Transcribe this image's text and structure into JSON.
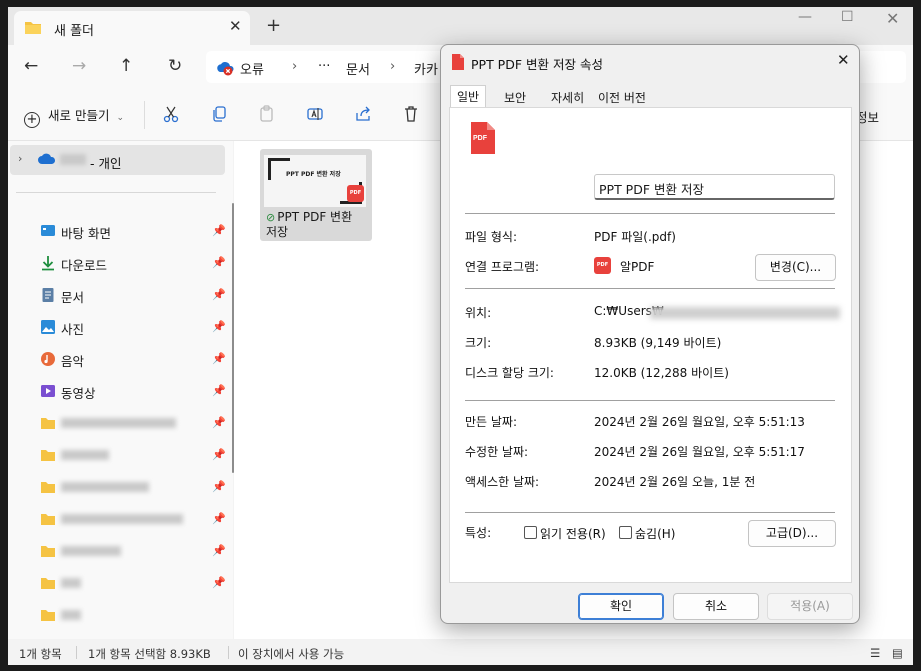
{
  "explorer": {
    "tab_title": "새 폴더",
    "breadcrumb": [
      "오류",
      "···",
      "문서",
      "카카"
    ],
    "new_button": "새로 만들기",
    "info_label": "정보",
    "onedrive_label": "- 개인",
    "quick_access": [
      {
        "label": "바탕 화면",
        "icon": "desktop-icon",
        "color": "#2a8bd8"
      },
      {
        "label": "다운로드",
        "icon": "download-icon",
        "color": "#1e8e3e"
      },
      {
        "label": "문서",
        "icon": "document-icon",
        "color": "#5b7fa6"
      },
      {
        "label": "사진",
        "icon": "pictures-icon",
        "color": "#2a8bd8"
      },
      {
        "label": "음악",
        "icon": "music-icon",
        "color": "#e86a3a"
      },
      {
        "label": "동영상",
        "icon": "video-icon",
        "color": "#7a4fd1"
      }
    ],
    "file": {
      "name": "PPT PDF 변환 저장",
      "thumb_text": "PPT PDF 변환 저장",
      "badge": "PDF"
    },
    "status": {
      "count": "1개 항목",
      "selected": "1개 항목 선택함 8.93KB",
      "availability": "이 장치에서 사용 가능"
    }
  },
  "dialog": {
    "title": "PPT PDF 변환 저장 속성",
    "tabs": [
      "일반",
      "보안",
      "자세히",
      "이전 버전"
    ],
    "file_name": "PPT PDF 변환 저장",
    "file_icon_label": "PDF",
    "rows": {
      "file_type_label": "파일 형식:",
      "file_type_value": "PDF 파일(.pdf)",
      "opens_with_label": "연결 프로그램:",
      "opens_with_value": "알PDF",
      "change_button": "변경(C)...",
      "location_label": "위치:",
      "location_value": "C:₩Users₩",
      "size_label": "크기:",
      "size_value": "8.93KB (9,149 바이트)",
      "disk_size_label": "디스크 할당 크기:",
      "disk_size_value": "12.0KB (12,288 바이트)",
      "created_label": "만든 날짜:",
      "created_value": "2024년 2월 26일 월요일, 오후 5:51:13",
      "modified_label": "수정한 날짜:",
      "modified_value": "2024년 2월 26일 월요일, 오후 5:51:17",
      "accessed_label": "액세스한 날짜:",
      "accessed_value": "2024년 2월 26일 오늘, 1분 전",
      "attributes_label": "특성:",
      "readonly_label": "읽기 전용(R)",
      "hidden_label": "숨김(H)",
      "advanced_button": "고급(D)..."
    },
    "buttons": {
      "ok": "확인",
      "cancel": "취소",
      "apply": "적용(A)"
    }
  },
  "colors": {
    "accent": "#3d7fd6",
    "pdf_red": "#e8413c",
    "folder": "#f5c343"
  }
}
